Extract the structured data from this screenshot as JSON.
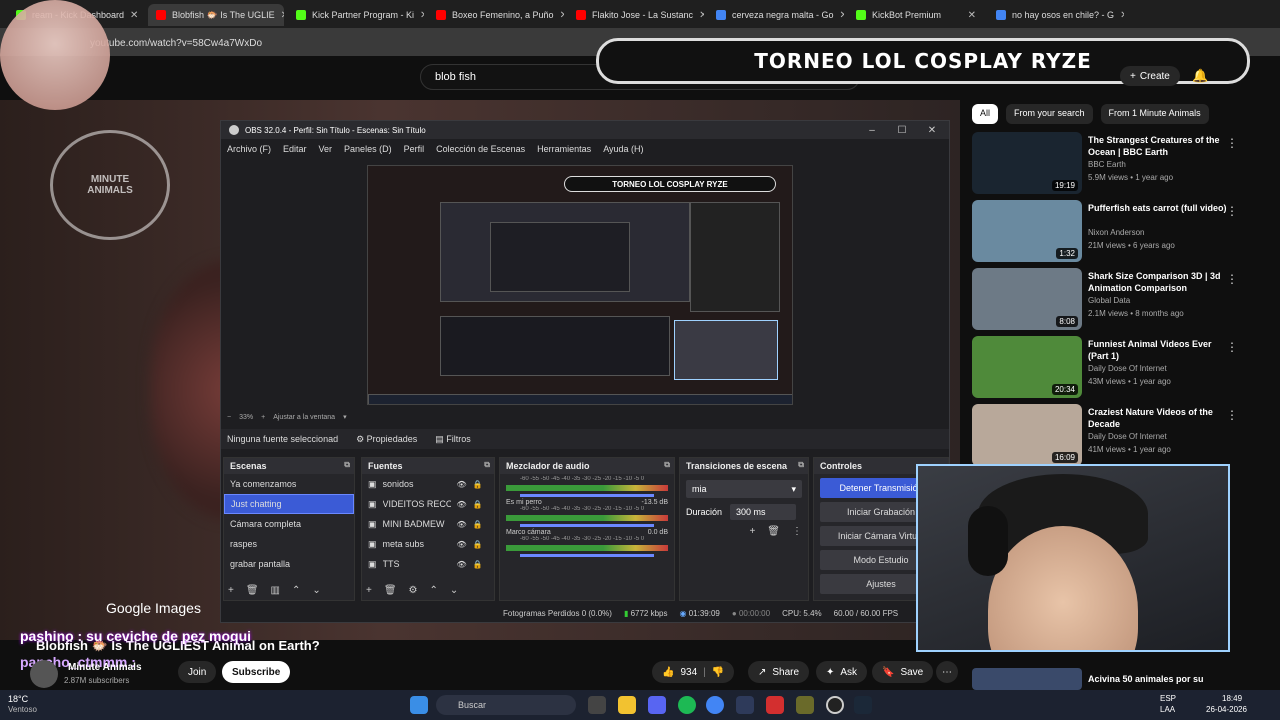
{
  "browser": {
    "tabs": [
      {
        "label": "ream - Kick Dashboard",
        "color": "#53fc18"
      },
      {
        "label": "Blobfish 🐡 Is The UGLIE",
        "color": "#ff0000",
        "active": true
      },
      {
        "label": "Kick Partner Program - Ki",
        "color": "#53fc18"
      },
      {
        "label": "Boxeo Femenino, a Puño",
        "color": "#ff0000"
      },
      {
        "label": "Flakito Jose - La Sustanc",
        "color": "#ff0000"
      },
      {
        "label": "cerveza negra malta - Go",
        "color": "#4285f4"
      },
      {
        "label": "KickBot Premium",
        "color": "#53fc18"
      },
      {
        "label": "no hay osos en chile? - G",
        "color": "#4285f4"
      }
    ],
    "url": "youtube.com/watch?v=58Cw4a7WxDo"
  },
  "youtube": {
    "search_value": "blob fish",
    "create_label": "Create",
    "banner_text": "TORNEO LOL COSPLAY RYZE",
    "chips": [
      "All",
      "From your search",
      "From 1 Minute Animals"
    ],
    "video_title": "Blobfish 🐡 Is The UGLIEST Animal on Earth?",
    "channel": "Minute Animals",
    "subs": "2.87M subscribers",
    "join_label": "Join",
    "subscribe_label": "Subscribe",
    "likes": "934",
    "share_label": "Share",
    "ask_label": "Ask",
    "save_label": "Save",
    "google_images": "Google Images",
    "chat_line_1": "pashino : su ceviche de pez moqui",
    "chat_line_2": "pancho_ctmmm :",
    "recommendations": [
      {
        "title": "The Strangest Creatures of the Ocean | BBC Earth",
        "channel": "BBC Earth",
        "meta": "5.9M views • 1 year ago",
        "duration": "19:19",
        "thumb": "#1a2530"
      },
      {
        "title": "Pufferfish eats carrot (full video)",
        "channel": "Nixon Anderson",
        "meta": "21M views • 6 years ago",
        "duration": "1:32",
        "thumb": "#6a8aa0"
      },
      {
        "title": "Shark Size Comparison 3D | 3d Animation Comparison",
        "channel": "Global Data",
        "meta": "2.1M views • 8 months ago",
        "duration": "8:08",
        "thumb": "#6d7a86"
      },
      {
        "title": "Funniest Animal Videos Ever (Part 1)",
        "channel": "Daily Dose Of Internet",
        "meta": "43M views • 1 year ago",
        "duration": "20:34",
        "thumb": "#4f8a3a"
      },
      {
        "title": "Craziest Nature Videos of the Decade",
        "channel": "Daily Dose Of Internet",
        "meta": "41M views • 1 year ago",
        "duration": "16:09",
        "thumb": "#b8a89a"
      }
    ],
    "bottom_rec": "Acivina 50 animales por su"
  },
  "obs": {
    "title": "OBS 32.0.4 - Perfil: Sin Título - Escenas: Sin Título",
    "menu": [
      "Archivo (F)",
      "Editar",
      "Ver",
      "Paneles (D)",
      "Perfil",
      "Colección de Escenas",
      "Herramientas",
      "Ayuda (H)"
    ],
    "preview_banner": "TORNEO LOL COSPLAY RYZE",
    "zoom": "33%",
    "fit_label": "Ajustar a la ventana",
    "no_source": "Ninguna fuente seleccionad",
    "properties_label": "Propiedades",
    "filters_label": "Filtros",
    "scenes_title": "Escenas",
    "scenes": [
      "Ya comenzamos",
      "Just chatting",
      "Cámara completa",
      "raspes",
      "grabar pantalla"
    ],
    "sources_title": "Fuentes",
    "sources": [
      "sonidos",
      "VIDEITOS RECOM",
      "MINI BADMEW",
      "meta subs",
      "TTS"
    ],
    "mixer_title": "Mezclador de audio",
    "mixer": [
      {
        "name": "",
        "db": ""
      },
      {
        "name": "Es mi perro",
        "db": "-13.5 dB"
      },
      {
        "name": "Marco cámara",
        "db": "0.0 dB"
      }
    ],
    "meter_scale": "-60 -55 -50 -45 -40 -35 -30 -25 -20 -15 -10 -5 0",
    "transitions_title": "Transiciones de escena",
    "transition_value": "mia",
    "duration_label": "Duración",
    "duration_value": "300 ms",
    "controls_title": "Controles",
    "controls": [
      "Detener Transmisión",
      "Iniciar Grabación",
      "Iniciar Cámara Virtual",
      "Modo Estudio",
      "Ajustes"
    ],
    "status": {
      "dropped": "Fotogramas Perdidos 0 (0.0%)",
      "bitrate": "6772 kbps",
      "live": "01:39:09",
      "rec": "00:00:00",
      "cpu": "CPU: 5.4%",
      "fps": "60.00 / 60.00 FPS"
    }
  },
  "taskbar": {
    "weather_temp": "18°C",
    "weather_desc": "Ventoso",
    "search_placeholder": "Buscar",
    "lang": "ESP",
    "lang2": "LAA",
    "time": "18:49",
    "date": "26-04-2026"
  }
}
